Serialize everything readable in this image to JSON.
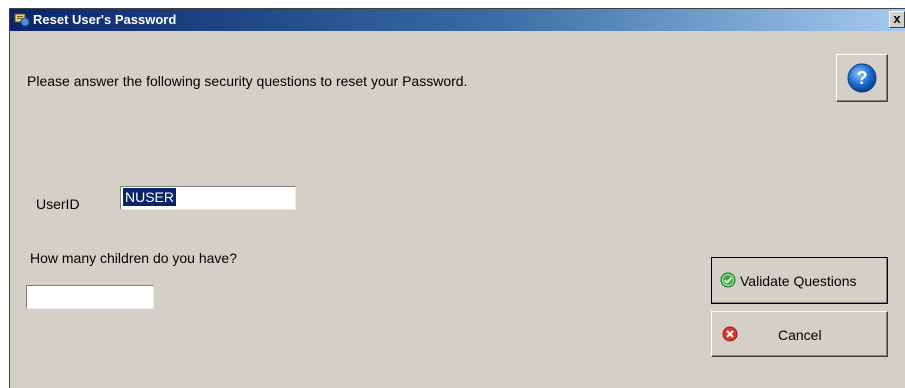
{
  "window": {
    "title": "Reset User's Password",
    "close_label": "x"
  },
  "instructions": "Please answer the following security questions to reset your Password.",
  "help_button": {
    "glyph": "?"
  },
  "userid": {
    "label": "UserID",
    "value": "NUSER"
  },
  "question": {
    "label": "How many children do you have?",
    "answer": ""
  },
  "buttons": {
    "validate_label": "Validate Questions",
    "cancel_label": "Cancel"
  },
  "colors": {
    "window_bg": "#d4d0c8",
    "title_start": "#0a246a",
    "title_end": "#a6caf0",
    "selection": "#0a246a",
    "help_blue": "#1c6fd0",
    "validate_green": "#3aa845",
    "cancel_red": "#d83a2a"
  },
  "icons": {
    "title": "app-icon",
    "help": "help-icon",
    "validate": "check-circle-icon",
    "cancel": "x-circle-icon"
  }
}
